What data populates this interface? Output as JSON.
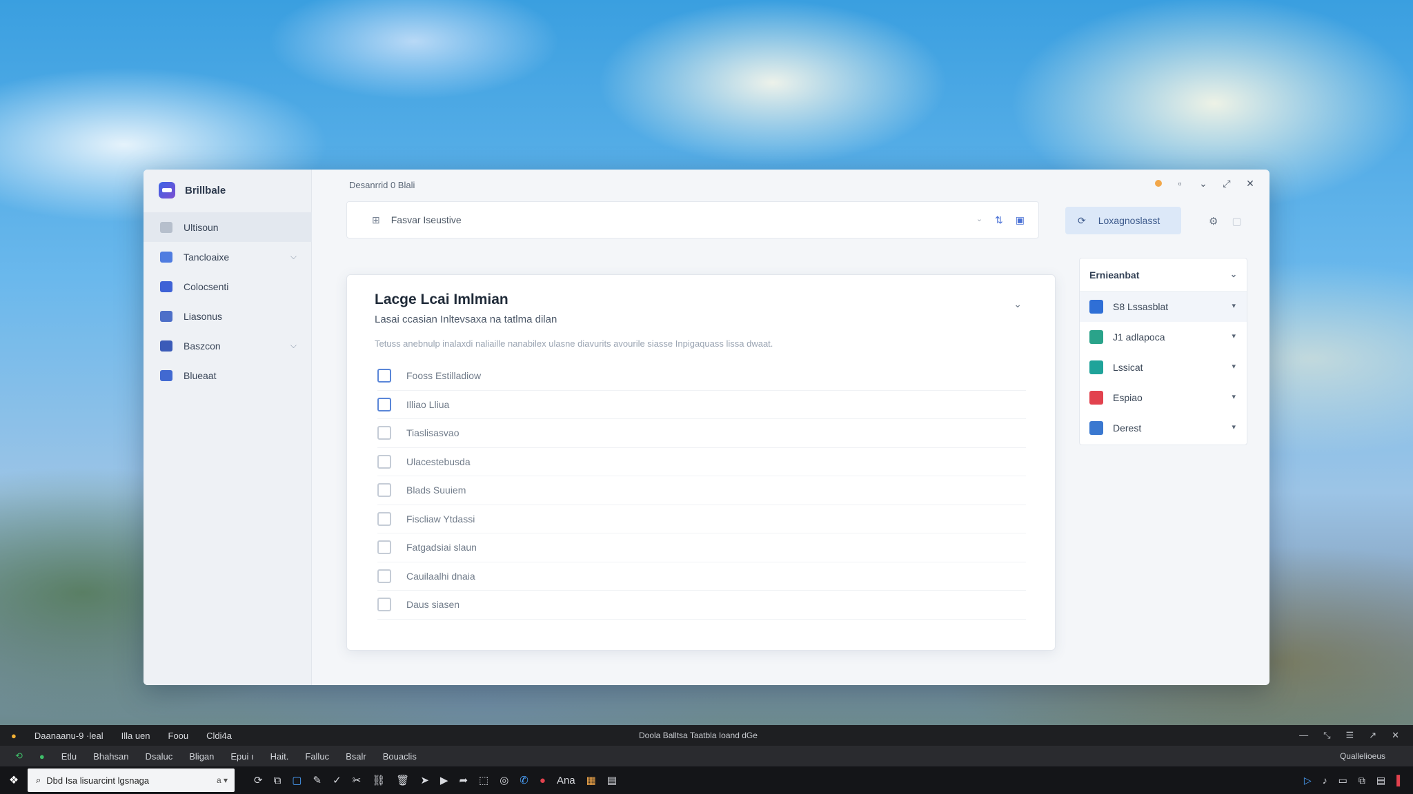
{
  "window": {
    "brand": "Brillbale",
    "title": "Desanrrid 0 Blali",
    "sidebar": {
      "items": [
        {
          "label": "Ultisoun",
          "icon": "grid-icon",
          "color": "#b6bfcc",
          "active": true,
          "chevron": ""
        },
        {
          "label": "Tancloaixe",
          "icon": "chart-icon",
          "color": "#4f7ce0",
          "active": false,
          "chevron": "⌵"
        },
        {
          "label": "Colocsenti",
          "icon": "user-icon",
          "color": "#3e62d6",
          "active": false,
          "chevron": ""
        },
        {
          "label": "Liasonus",
          "icon": "document-icon",
          "color": "#4d6fc8",
          "active": false,
          "chevron": ""
        },
        {
          "label": "Baszcon",
          "icon": "users-icon",
          "color": "#3b5bb8",
          "active": false,
          "chevron": "⌵"
        },
        {
          "label": "Blueaat",
          "icon": "flag-icon",
          "color": "#4169d1",
          "active": false,
          "chevron": ""
        }
      ]
    },
    "search": {
      "icon": "filter-icon",
      "text": "Fasvar Iseustive"
    },
    "action_button": {
      "label": "Loxagnoslasst"
    },
    "card": {
      "title": "Lacge Lcai Imlmian",
      "subtitle": "Lasai ccasian Inltevsaxa na tatlma dilan",
      "description": "Tetuss anebnulp inalaxdi naliaille nanabilex ulasne diavurits avourile siasse Inpigaquass lissa dwaat.",
      "items": [
        {
          "label": "Fooss Estilladiow",
          "checkbox": "blue"
        },
        {
          "label": "Illiao Lliua",
          "checkbox": "blue"
        },
        {
          "label": "Tiaslisasvao",
          "checkbox": "grey"
        },
        {
          "label": "Ulacestebusda",
          "checkbox": "grey"
        },
        {
          "label": "Blads Suuiem",
          "checkbox": "grey"
        },
        {
          "label": "Fiscliaw Ytdassi",
          "checkbox": "grey"
        },
        {
          "label": "Fatgadsiai slaun",
          "checkbox": "grey"
        },
        {
          "label": "Cauilaalhi dnaia",
          "checkbox": "grey"
        },
        {
          "label": "Daus siasen",
          "checkbox": "grey"
        }
      ]
    },
    "panel": {
      "title": "Ernieanbat",
      "items": [
        {
          "label": "S8 Lssasblat",
          "icon": "bookmark-icon",
          "color": "#2f6fd6"
        },
        {
          "label": "J1 adlapoca",
          "icon": "person-icon",
          "color": "#2aa38a"
        },
        {
          "label": "Lssicat",
          "icon": "calendar-icon",
          "color": "#1fa39a"
        },
        {
          "label": "Espiao",
          "icon": "alert-icon",
          "color": "#e2424e"
        },
        {
          "label": "Derest",
          "icon": "monitor-icon",
          "color": "#3a78d0"
        }
      ]
    }
  },
  "appbar1": {
    "left": [
      "Daanaanu-9 ·leal",
      "Illa uen",
      "Foou",
      "Cldi4a"
    ],
    "center": "Doola Balltsa Taatbla Ioand dGe",
    "right": [
      "—",
      "⤡",
      "☰",
      "↗",
      "✕"
    ]
  },
  "appbar2": {
    "items": [
      "Etlu",
      "Bhahsan",
      "Dsaluc",
      "Bligan",
      "Epui ı",
      "Hait.",
      "Falluc",
      "Bsalr",
      "Bouaclis"
    ],
    "right": "Quallelioeus"
  },
  "taskbar": {
    "search_text": "Dbd Isa lisuarcint lgsnaga",
    "search_suffix": "a",
    "app_label": "Ana"
  }
}
